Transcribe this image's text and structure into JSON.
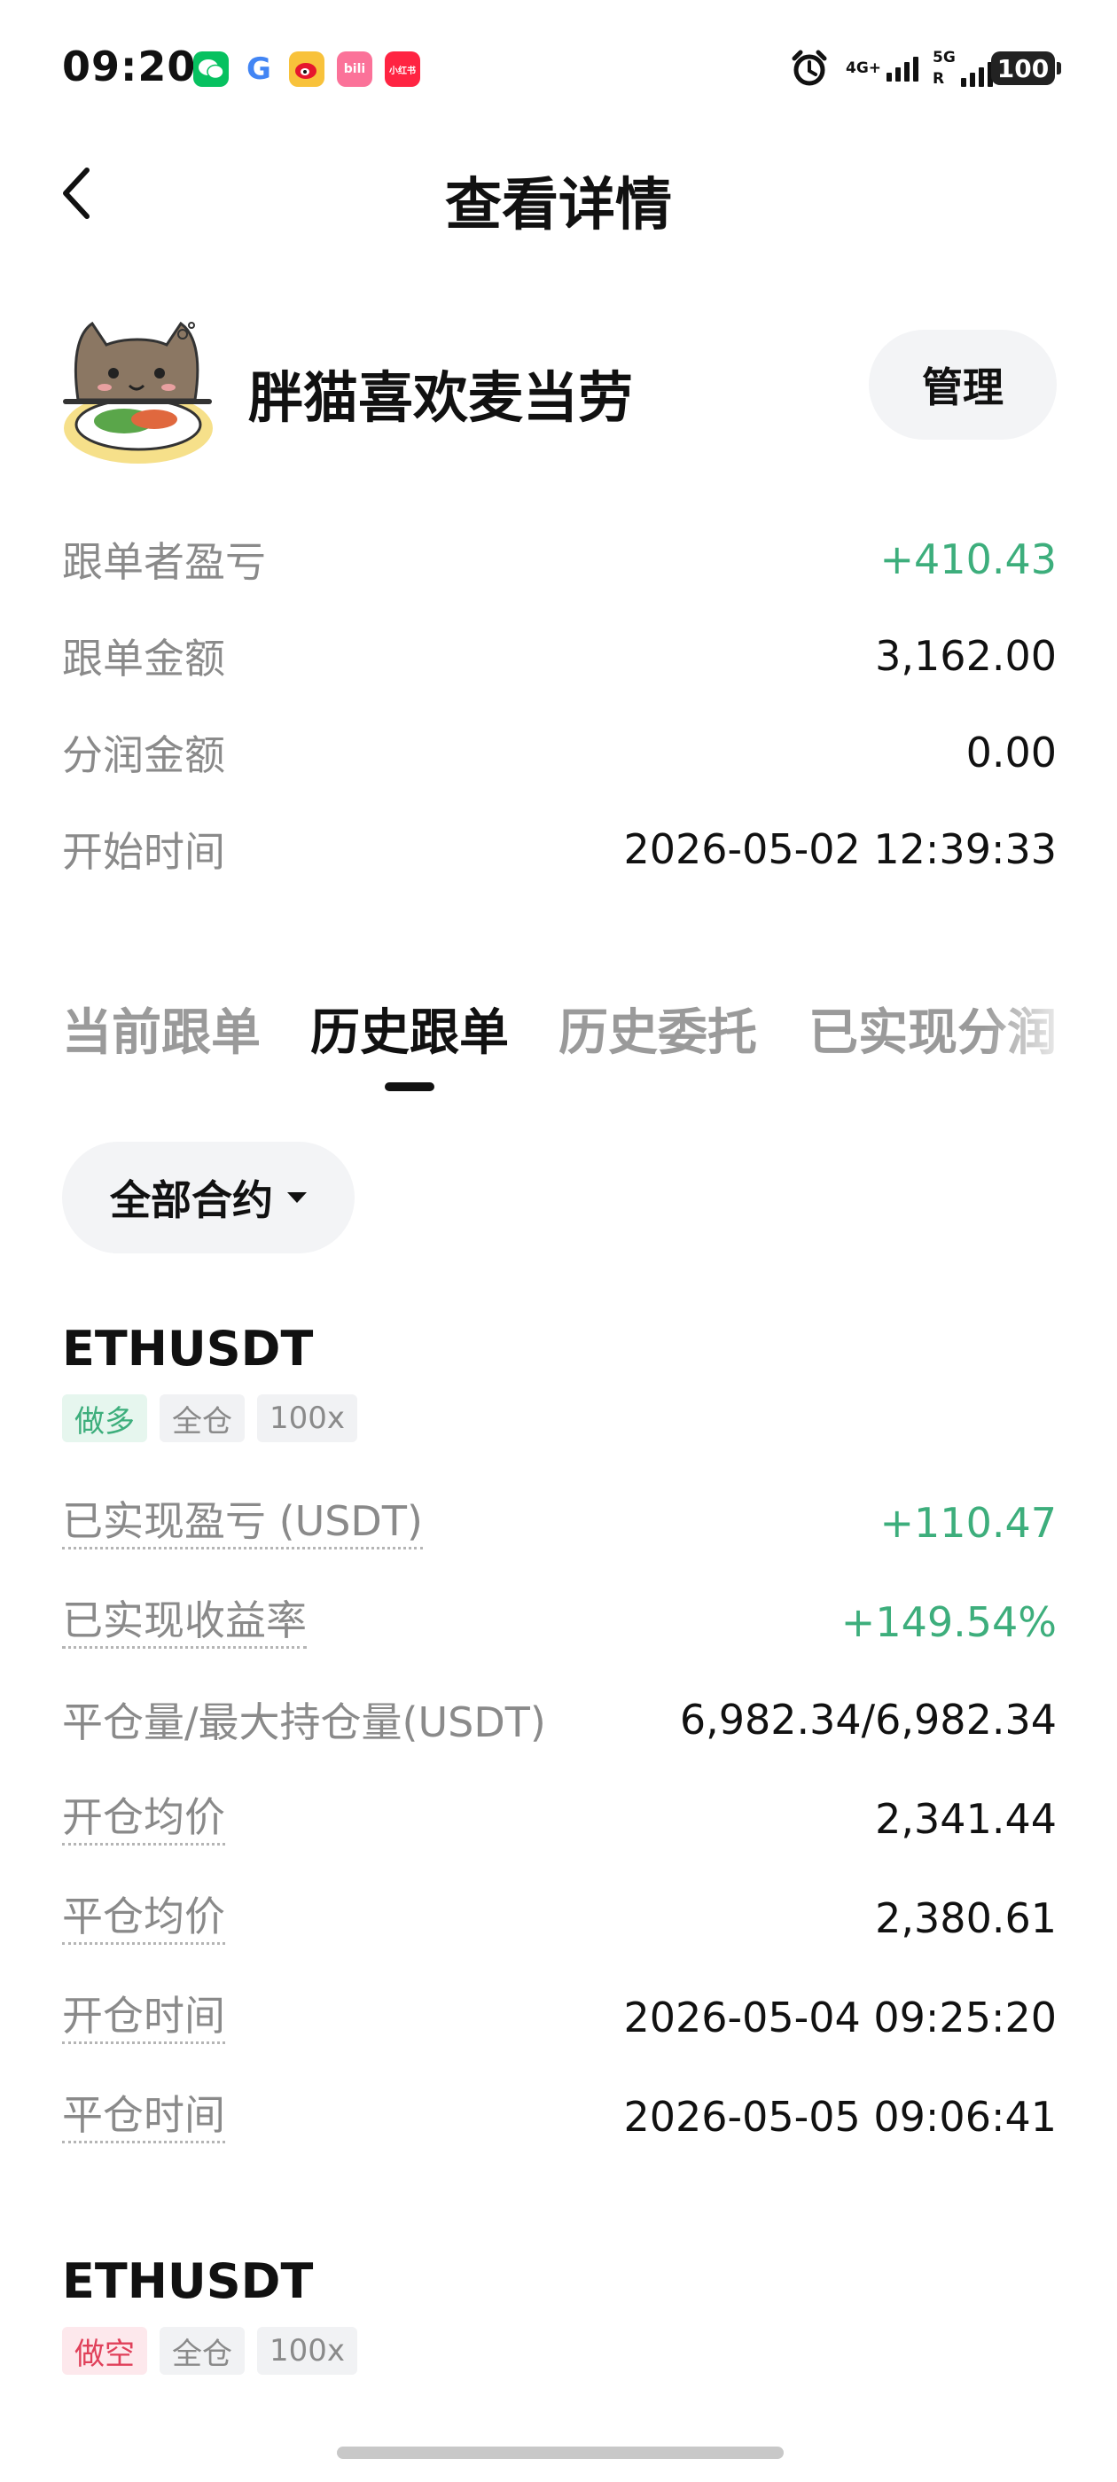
{
  "status_bar": {
    "time": "09:20",
    "apps": [
      {
        "icon": "wechat-icon",
        "color": "#07c160",
        "label": ""
      },
      {
        "icon": "google-icon",
        "color": "#ffffff",
        "label": "G"
      },
      {
        "icon": "weibo-icon",
        "color": "#f8c23b",
        "label": ""
      },
      {
        "icon": "bilibili-icon",
        "color": "#fb7299",
        "label": "bili"
      },
      {
        "icon": "xiaohongshu-icon",
        "color": "#ff2442",
        "label": "小红书"
      }
    ],
    "network_1": "4G+",
    "network_2": "5G",
    "roaming": "R",
    "battery": "100"
  },
  "header": {
    "title": "查看详情",
    "back_icon": "chevron-left-icon"
  },
  "profile": {
    "name": "胖猫喜欢麦当劳",
    "manage_label": "管理"
  },
  "summary": [
    {
      "label": "跟单者盈亏",
      "value": "+410.43",
      "color": "#3dae7c"
    },
    {
      "label": "跟单金额",
      "value": "3,162.00"
    },
    {
      "label": "分润金额",
      "value": "0.00"
    },
    {
      "label": "开始时间",
      "value": "2026-05-02 12:39:33"
    }
  ],
  "tabs": [
    {
      "label": "当前跟单",
      "active": false
    },
    {
      "label": "历史跟单",
      "active": true
    },
    {
      "label": "历史委托",
      "active": false
    },
    {
      "label": "已实现分润",
      "active": false
    }
  ],
  "filter": {
    "label": "全部合约"
  },
  "positions": [
    {
      "symbol": "ETHUSDT",
      "side": "做多",
      "margin_mode": "全仓",
      "leverage": "100x",
      "rows": [
        {
          "label": "已实现盈亏 (USDT)",
          "value": "+110.47"
        },
        {
          "label": "已实现收益率",
          "value": "+149.54%"
        },
        {
          "label": "平仓量/最大持仓量(USDT)",
          "value": "6,982.34/6,982.34"
        },
        {
          "label": "开仓均价",
          "value": "2,341.44"
        },
        {
          "label": "平仓均价",
          "value": "2,380.61"
        },
        {
          "label": "开仓时间",
          "value": "2026-05-04 09:25:20"
        },
        {
          "label": "平仓时间",
          "value": "2026-05-05 09:06:41"
        }
      ]
    },
    {
      "symbol": "ETHUSDT",
      "side": "做空",
      "margin_mode": "全仓",
      "leverage": "100x"
    }
  ],
  "colors": {
    "positive": "#3dae7c",
    "short": "#e0405a",
    "muted": "#8a8a8a"
  }
}
